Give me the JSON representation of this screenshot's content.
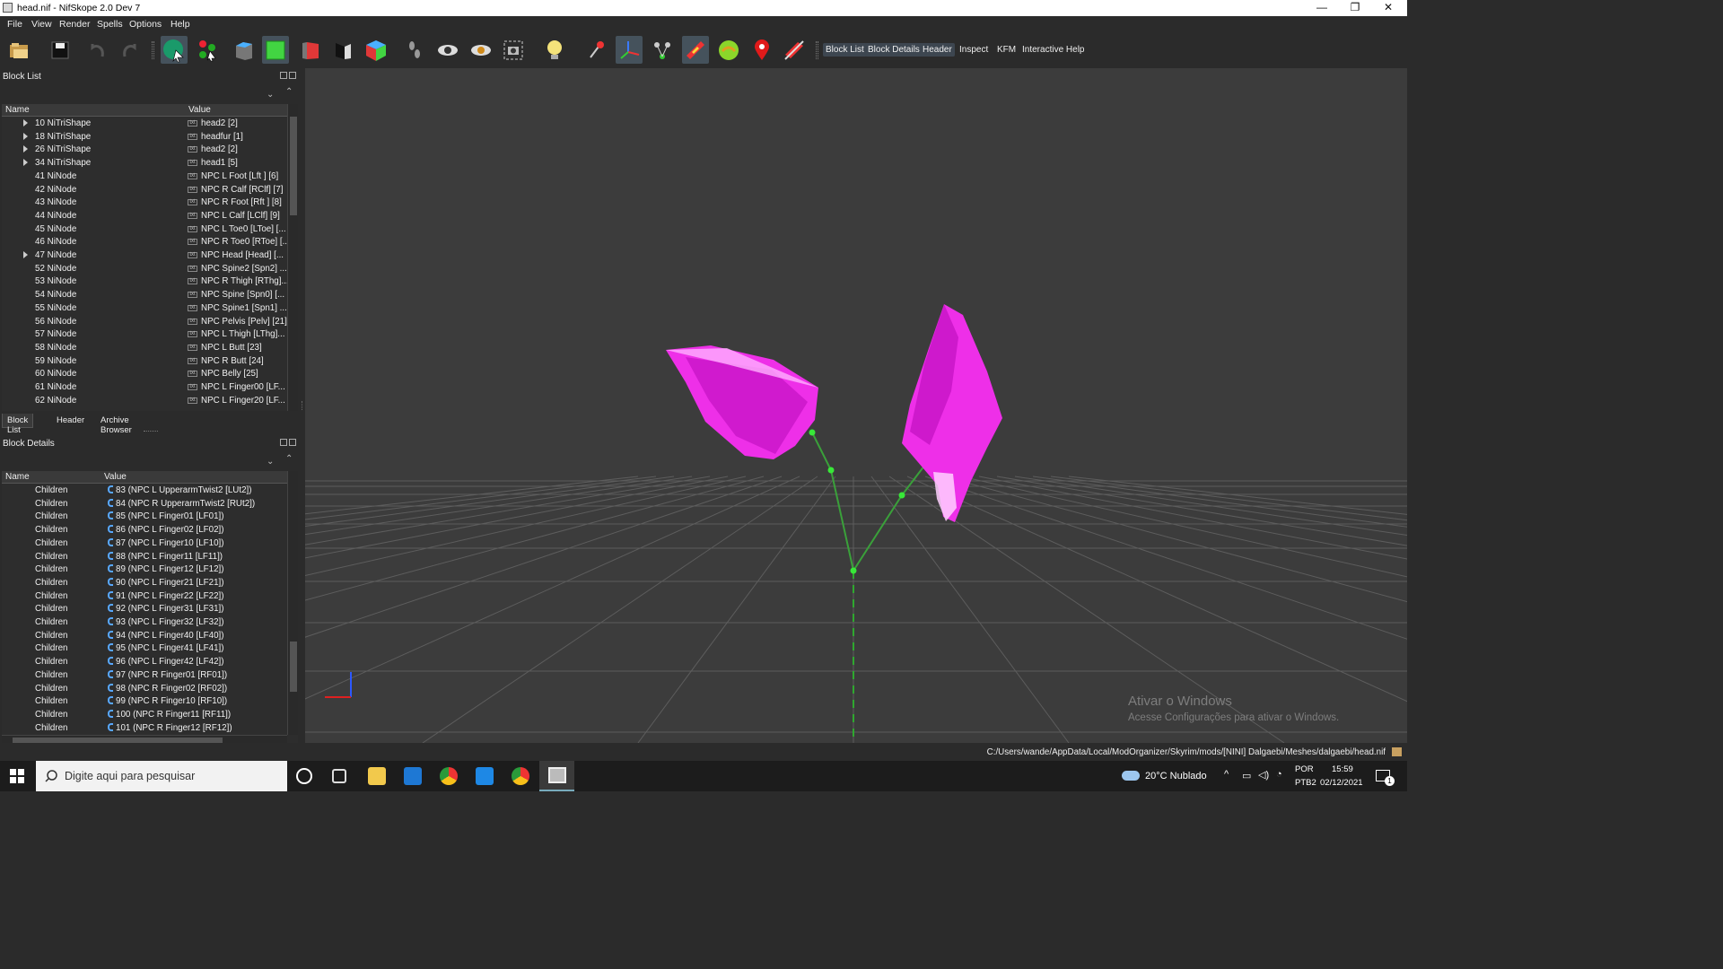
{
  "window": {
    "title": "head.nif - NifSkope 2.0 Dev 7",
    "minimize": "—",
    "restore": "❐",
    "close": "✕"
  },
  "menu": [
    "File",
    "View",
    "Render",
    "Spells",
    "Options",
    "Help"
  ],
  "toolbar": {
    "text_buttons": [
      "Block List",
      "Block Details",
      "Header",
      "Inspect",
      "KFM",
      "Interactive Help"
    ]
  },
  "block_list": {
    "title": "Block List",
    "columns": [
      "Name",
      "Value"
    ],
    "rows": [
      {
        "name": "10 NiTriShape",
        "value": "head2 [2]",
        "expand": true
      },
      {
        "name": "18 NiTriShape",
        "value": "headfur [1]",
        "expand": true
      },
      {
        "name": "26 NiTriShape",
        "value": "head2 [2]",
        "expand": true
      },
      {
        "name": "34 NiTriShape",
        "value": "head1 [5]",
        "expand": true
      },
      {
        "name": "41 NiNode",
        "value": "NPC L Foot [Lft ] [6]",
        "expand": false
      },
      {
        "name": "42 NiNode",
        "value": "NPC R Calf [RClf] [7]",
        "expand": false
      },
      {
        "name": "43 NiNode",
        "value": "NPC R Foot [Rft ] [8]",
        "expand": false
      },
      {
        "name": "44 NiNode",
        "value": "NPC L Calf [LClf] [9]",
        "expand": false
      },
      {
        "name": "45 NiNode",
        "value": "NPC L Toe0 [LToe] [...",
        "expand": false
      },
      {
        "name": "46 NiNode",
        "value": "NPC R Toe0 [RToe] [...",
        "expand": false
      },
      {
        "name": "47 NiNode",
        "value": "NPC Head [Head] [...",
        "expand": true
      },
      {
        "name": "52 NiNode",
        "value": "NPC Spine2 [Spn2] ...",
        "expand": false
      },
      {
        "name": "53 NiNode",
        "value": "NPC R Thigh [RThg]...",
        "expand": false
      },
      {
        "name": "54 NiNode",
        "value": "NPC Spine [Spn0] [...",
        "expand": false
      },
      {
        "name": "55 NiNode",
        "value": "NPC Spine1 [Spn1] ...",
        "expand": false
      },
      {
        "name": "56 NiNode",
        "value": "NPC Pelvis [Pelv] [21]",
        "expand": false
      },
      {
        "name": "57 NiNode",
        "value": "NPC L Thigh [LThg]...",
        "expand": false
      },
      {
        "name": "58 NiNode",
        "value": "NPC L Butt [23]",
        "expand": false
      },
      {
        "name": "59 NiNode",
        "value": "NPC R Butt [24]",
        "expand": false
      },
      {
        "name": "60 NiNode",
        "value": "NPC Belly [25]",
        "expand": false
      },
      {
        "name": "61 NiNode",
        "value": "NPC L Finger00 [LF...",
        "expand": false
      },
      {
        "name": "62 NiNode",
        "value": "NPC L Finger20 [LF...",
        "expand": false
      }
    ],
    "tabs": [
      "Block List",
      "Header",
      "Archive Browser"
    ]
  },
  "block_details": {
    "title": "Block Details",
    "columns": [
      "Name",
      "Value"
    ],
    "rows": [
      {
        "name": "Children",
        "value": "83 (NPC L UpperarmTwist2 [LUt2])"
      },
      {
        "name": "Children",
        "value": "84 (NPC R UpperarmTwist2 [RUt2])"
      },
      {
        "name": "Children",
        "value": "85 (NPC L Finger01 [LF01])"
      },
      {
        "name": "Children",
        "value": "86 (NPC L Finger02 [LF02])"
      },
      {
        "name": "Children",
        "value": "87 (NPC L Finger10 [LF10])"
      },
      {
        "name": "Children",
        "value": "88 (NPC L Finger11 [LF11])"
      },
      {
        "name": "Children",
        "value": "89 (NPC L Finger12 [LF12])"
      },
      {
        "name": "Children",
        "value": "90 (NPC L Finger21 [LF21])"
      },
      {
        "name": "Children",
        "value": "91 (NPC L Finger22 [LF22])"
      },
      {
        "name": "Children",
        "value": "92 (NPC L Finger31 [LF31])"
      },
      {
        "name": "Children",
        "value": "93 (NPC L Finger32 [LF32])"
      },
      {
        "name": "Children",
        "value": "94 (NPC L Finger40 [LF40])"
      },
      {
        "name": "Children",
        "value": "95 (NPC L Finger41 [LF41])"
      },
      {
        "name": "Children",
        "value": "96 (NPC L Finger42 [LF42])"
      },
      {
        "name": "Children",
        "value": "97 (NPC R Finger01 [RF01])"
      },
      {
        "name": "Children",
        "value": "98 (NPC R Finger02 [RF02])"
      },
      {
        "name": "Children",
        "value": "99 (NPC R Finger10 [RF10])"
      },
      {
        "name": "Children",
        "value": "100 (NPC R Finger11 [RF11])"
      },
      {
        "name": "Children",
        "value": "101 (NPC R Finger12 [RF12])"
      }
    ]
  },
  "viewport": {
    "watermark_title": "Ativar o Windows",
    "watermark_sub": "Acesse Configurações para ativar o Windows."
  },
  "status": {
    "path": "C:/Users/wande/AppData/Local/ModOrganizer/Skyrim/mods/[NINI] Dalgaebi/Meshes/dalgaebi/head.nif"
  },
  "taskbar": {
    "search_placeholder": "Digite aqui para pesquisar",
    "weather": "20°C  Nublado",
    "lang1": "POR",
    "lang2": "PTB2",
    "time": "15:59",
    "date": "02/12/2021",
    "notif": "1"
  }
}
